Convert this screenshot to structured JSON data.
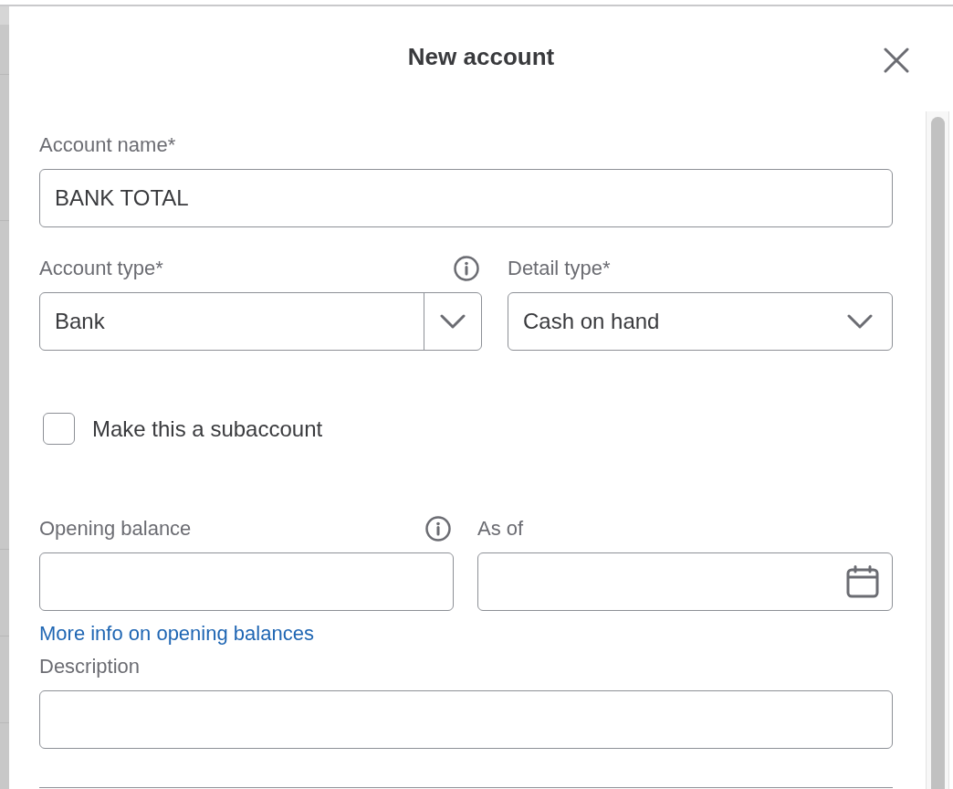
{
  "dialog": {
    "title": "New account"
  },
  "account_name": {
    "label": "Account name*",
    "value": "BANK TOTAL"
  },
  "account_type": {
    "label": "Account type*",
    "value": "Bank"
  },
  "detail_type": {
    "label": "Detail type*",
    "value": "Cash on hand"
  },
  "subaccount": {
    "label": "Make this a subaccount",
    "checked": false
  },
  "opening_balance": {
    "label": "Opening balance"
  },
  "as_of": {
    "label": "As of"
  },
  "opening_balance_link": "More info on opening balances",
  "description": {
    "label": "Description"
  }
}
